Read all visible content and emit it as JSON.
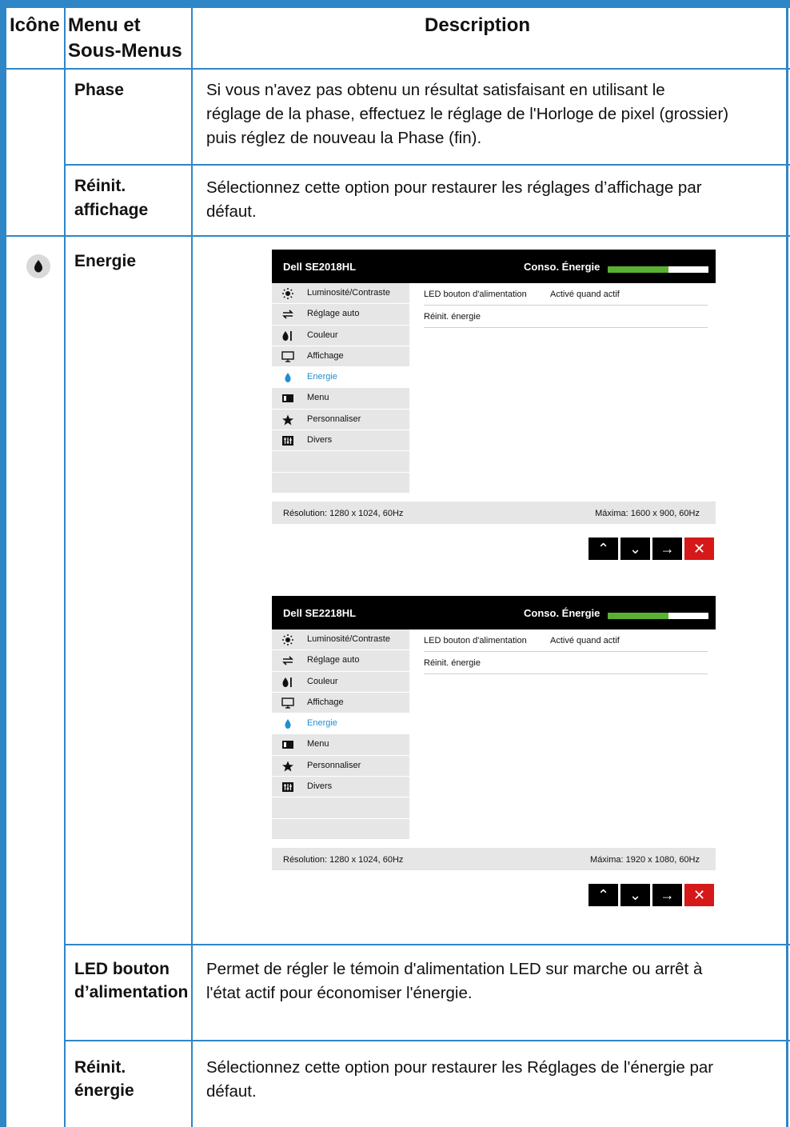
{
  "header": {
    "icon_col": "Icône",
    "menu_col_line1": "Menu et",
    "menu_col_line2": "Sous-Menus",
    "desc_col": "Description"
  },
  "rows": {
    "phase": {
      "label": "Phase",
      "desc_l1": "Si vous n'avez pas obtenu un résultat satisfaisant en utilisant le",
      "desc_l2": "réglage de la phase, effectuez le réglage de l'Horloge de pixel (grossier)",
      "desc_l3": "puis réglez de nouveau la Phase (fin)."
    },
    "reinit_affichage": {
      "label_l1": "Réinit.",
      "label_l2": "affichage",
      "desc_l1": "Sélectionnez cette option pour restaurer les réglages d’affichage par",
      "desc_l2": "défaut."
    },
    "energie": {
      "label": "Energie"
    },
    "led": {
      "label_l1": "LED bouton",
      "label_l2": "d’alimentation",
      "desc_l1": "Permet de régler le témoin d'alimentation LED sur marche ou arrêt à",
      "desc_l2": "l'état actif pour économiser l'énergie."
    },
    "reinit_energie": {
      "label_l1": "Réinit.",
      "label_l2": "énergie",
      "desc_l1": "Sélectionnez cette option pour restaurer les Réglages de l'énergie par",
      "desc_l2": "défaut."
    }
  },
  "osd1": {
    "model": "Dell SE2018HL",
    "conso_label": "Conso. Énergie",
    "conso_level": 0.6,
    "menu": [
      "Luminosité/Contraste",
      "Réglage auto",
      "Couleur",
      "Affichage",
      "Energie",
      "Menu",
      "Personnaliser",
      "Divers"
    ],
    "active_index": 4,
    "led_key": "LED bouton d'alimentation",
    "led_value": "Activé quand actif",
    "reset_key": "Réinit. énergie",
    "resolution": "Résolution: 1280 x 1024, 60Hz",
    "maxima": "Máxima: 1600 x 900, 60Hz"
  },
  "osd2": {
    "model": "Dell SE2218HL",
    "conso_label": "Conso. Énergie",
    "conso_level": 0.6,
    "menu": [
      "Luminosité/Contraste",
      "Réglage auto",
      "Couleur",
      "Affichage",
      "Energie",
      "Menu",
      "Personnaliser",
      "Divers"
    ],
    "active_index": 4,
    "led_key": "LED bouton d'alimentation",
    "led_value": "Activé quand actif",
    "reset_key": "Réinit. énergie",
    "resolution": "Résolution: 1280 x 1024, 60Hz",
    "maxima": "Máxima: 1920 x 1080, 60Hz"
  },
  "icons": {
    "energy": "energy-drop-icon",
    "buttons": [
      "up-icon",
      "down-icon",
      "right-arrow-icon",
      "close-icon"
    ]
  },
  "colors": {
    "frame": "#2f86c6",
    "active": "#1f8fd0",
    "conso_fill": "#59b134",
    "exit": "#d61818"
  }
}
